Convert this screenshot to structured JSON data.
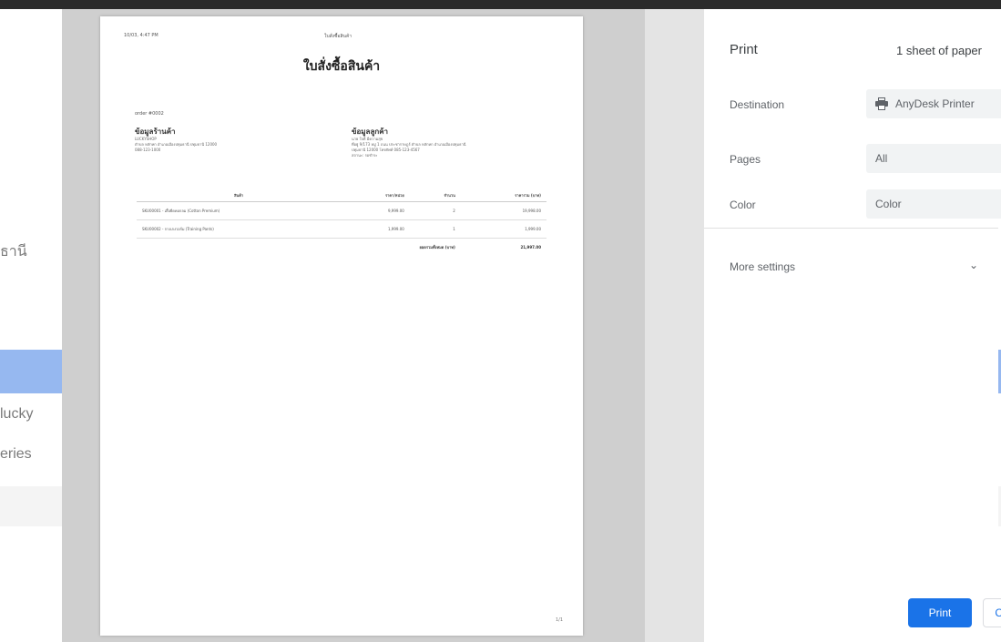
{
  "background": {
    "texts": [
      "ธานี",
      "lucky",
      "eries"
    ]
  },
  "preview": {
    "header_left": "10/03, 4:47 PM",
    "header_center": "ใบสั่งซื้อสินค้า",
    "title": "ใบสั่งซื้อสินค้า",
    "order_no": "order #0002",
    "shop": {
      "heading": "ข้อมูลร้านค้า",
      "lines": [
        "LUCKYSHOP",
        "ตำบล หลักหก อำเภอเมืองปทุมธานี ปทุมธานี 12000",
        "088-123-1000"
      ]
    },
    "customer": {
      "heading": "ข้อมูลลูกค้า",
      "lines": [
        "นาย ใจดี มีความสุข",
        "ที่อยู่ 9/173 หมู่ 1 ถนน ประชาราษฎร์ ตำบล หลักหก อำเภอเมืองปทุมธานี",
        "ปทุมธานี 12000 โทรศัพท์ 085-123-4567",
        "สถานะ: รอชำระ"
      ]
    },
    "table": {
      "headers": [
        "สินค้า",
        "ราคา/หน่วย",
        "จำนวน",
        "ราคารวม (บาท)"
      ],
      "rows": [
        [
          "SKU00001 - เสื้อยืดคอกลม (Cotton Premium)",
          "9,999.00",
          "2",
          "19,998.00"
        ],
        [
          "SKU00002 - กางเกงวอร์ม (Training Pants)",
          "1,999.00",
          "1",
          "1,999.00"
        ]
      ],
      "total_label": "ยอดรวมทั้งหมด (บาท)",
      "total_value": "21,997.00"
    },
    "page_number": "1/1"
  },
  "settings": {
    "title": "Print",
    "sheet_count": "1 sheet of paper",
    "destination": {
      "label": "Destination",
      "value": "AnyDesk Printer"
    },
    "pages": {
      "label": "Pages",
      "value": "All"
    },
    "color": {
      "label": "Color",
      "value": "Color"
    },
    "more_settings": "More settings",
    "print_button": "Print",
    "cancel_button": "Cancel"
  },
  "colors": {
    "accent": "#1a73e8",
    "background_blue_bar": "#5f93e8"
  },
  "icons": {
    "printer": "printer-icon",
    "dropdown": "chevron-down-icon"
  }
}
